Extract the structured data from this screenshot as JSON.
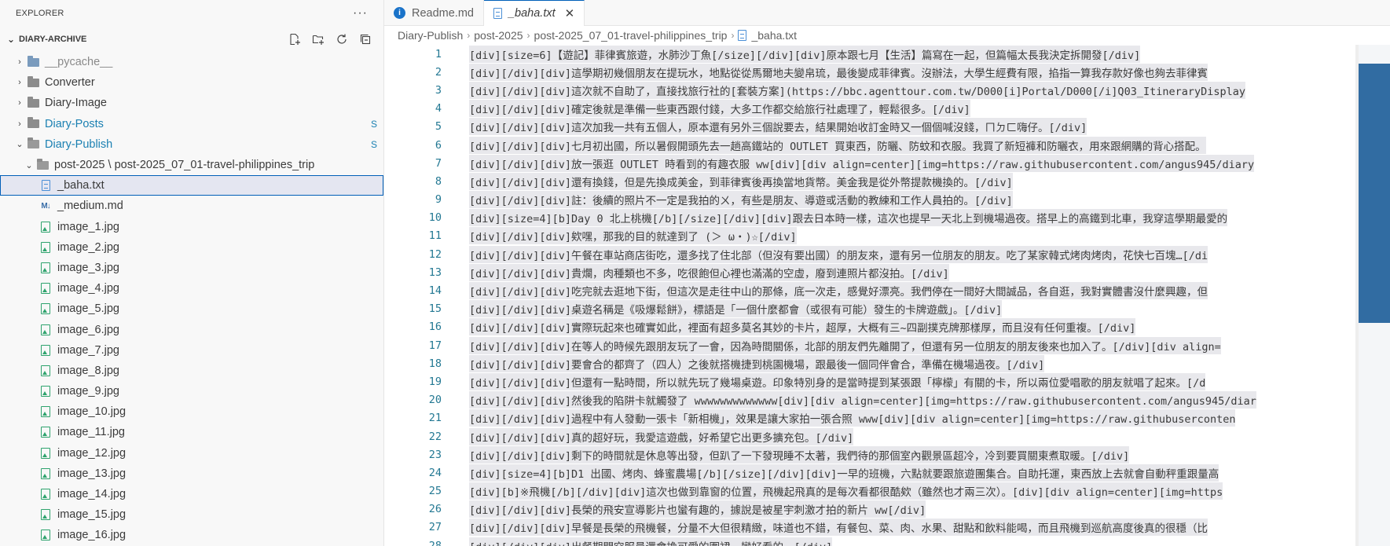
{
  "sidebar": {
    "header": "EXPLORER",
    "more_label": "···",
    "section_title": "DIARY-ARCHIVE",
    "actions": [
      "new-file-icon",
      "new-folder-icon",
      "refresh-icon",
      "collapse-all-icon"
    ],
    "items": [
      {
        "label": "__pycache__",
        "kind": "folder-py",
        "depth": 1,
        "twisty": "›",
        "badge": "",
        "style": "dim"
      },
      {
        "label": "Converter",
        "kind": "folder",
        "depth": 1,
        "twisty": "›",
        "badge": "",
        "style": ""
      },
      {
        "label": "Diary-Image",
        "kind": "folder",
        "depth": 1,
        "twisty": "›",
        "badge": "",
        "style": ""
      },
      {
        "label": "Diary-Posts",
        "kind": "folder",
        "depth": 1,
        "twisty": "›",
        "badge": "S",
        "style": "mod"
      },
      {
        "label": "Diary-Publish",
        "kind": "folder-open",
        "depth": 1,
        "twisty": "⌄",
        "badge": "S",
        "style": "mod"
      },
      {
        "label": "post-2025 \\ post-2025_07_01-travel-philippines_trip",
        "kind": "folder-open",
        "depth": 2,
        "twisty": "⌄",
        "badge": "",
        "style": ""
      },
      {
        "label": "_baha.txt",
        "kind": "txt",
        "depth": 3,
        "twisty": "",
        "badge": "",
        "style": "",
        "selected": true
      },
      {
        "label": "_medium.md",
        "kind": "md",
        "depth": 3,
        "twisty": "",
        "badge": "",
        "style": ""
      },
      {
        "label": "image_1.jpg",
        "kind": "img",
        "depth": 3,
        "twisty": "",
        "badge": "",
        "style": ""
      },
      {
        "label": "image_2.jpg",
        "kind": "img",
        "depth": 3,
        "twisty": "",
        "badge": "",
        "style": ""
      },
      {
        "label": "image_3.jpg",
        "kind": "img",
        "depth": 3,
        "twisty": "",
        "badge": "",
        "style": ""
      },
      {
        "label": "image_4.jpg",
        "kind": "img",
        "depth": 3,
        "twisty": "",
        "badge": "",
        "style": ""
      },
      {
        "label": "image_5.jpg",
        "kind": "img",
        "depth": 3,
        "twisty": "",
        "badge": "",
        "style": ""
      },
      {
        "label": "image_6.jpg",
        "kind": "img",
        "depth": 3,
        "twisty": "",
        "badge": "",
        "style": ""
      },
      {
        "label": "image_7.jpg",
        "kind": "img",
        "depth": 3,
        "twisty": "",
        "badge": "",
        "style": ""
      },
      {
        "label": "image_8.jpg",
        "kind": "img",
        "depth": 3,
        "twisty": "",
        "badge": "",
        "style": ""
      },
      {
        "label": "image_9.jpg",
        "kind": "img",
        "depth": 3,
        "twisty": "",
        "badge": "",
        "style": ""
      },
      {
        "label": "image_10.jpg",
        "kind": "img",
        "depth": 3,
        "twisty": "",
        "badge": "",
        "style": ""
      },
      {
        "label": "image_11.jpg",
        "kind": "img",
        "depth": 3,
        "twisty": "",
        "badge": "",
        "style": ""
      },
      {
        "label": "image_12.jpg",
        "kind": "img",
        "depth": 3,
        "twisty": "",
        "badge": "",
        "style": ""
      },
      {
        "label": "image_13.jpg",
        "kind": "img",
        "depth": 3,
        "twisty": "",
        "badge": "",
        "style": ""
      },
      {
        "label": "image_14.jpg",
        "kind": "img",
        "depth": 3,
        "twisty": "",
        "badge": "",
        "style": ""
      },
      {
        "label": "image_15.jpg",
        "kind": "img",
        "depth": 3,
        "twisty": "",
        "badge": "",
        "style": ""
      },
      {
        "label": "image_16.jpg",
        "kind": "img",
        "depth": 3,
        "twisty": "",
        "badge": "",
        "style": ""
      }
    ]
  },
  "tabs": [
    {
      "label": "Readme.md",
      "icon": "info-icon",
      "active": false
    },
    {
      "label": "_baha.txt",
      "icon": "text-file-icon",
      "active": true,
      "close": "✕"
    }
  ],
  "breadcrumb": [
    "Diary-Publish",
    "post-2025",
    "post-2025_07_01-travel-philippines_trip",
    "_baha.txt"
  ],
  "breadcrumb_sep": "›",
  "colors": {
    "accent": "#005fb8",
    "badge": "#1b80b2",
    "line_number": "#237893",
    "minimap_slider": "#1f5f9a"
  },
  "editor": {
    "lines": [
      "[div][size=6]【遊記】菲律賓旅遊，水肺沙丁魚[/size][/div][div]原本跟七月【生活】篇寫在一起，但篇幅太長我決定拆開發[/div]",
      "[div][/div][div]這學期初幾個朋友在提玩水，地點從從馬爾地夫變帛琉，最後變成菲律賓。沒辦法，大學生經費有限，掐指一算我存款好像也夠去菲律賓",
      "[div][/div][div]這次就不自助了，直接找旅行社的[套裝方案](https://bbc.agenttour.com.tw/D000[i]Portal/D000[/i]Q03_ItineraryDisplay",
      "[div][/div][div]確定後就是準備一些東西跟付錢，大多工作都交給旅行社處理了，輕鬆很多。[/div]",
      "[div][/div][div]這次加我一共有五個人，原本還有另外三個說要去，結果開始收訂金時又一個個喊沒錢，ㄇㄉㄈ嗨仔。[/div]",
      "[div][/div][div]七月初出國，所以暑假開頭先去一趟高鐵站的 OUTLET 買東西，防曬、防蚊和衣服。我買了新短褲和防曬衣，用來跟網購的背心搭配。",
      "[div][/div][div]放一張逛 OUTLET 時看到的有趣衣服 ww[div][div align=center][img=https://raw.githubusercontent.com/angus945/diary",
      "[div][/div][div]還有換錢，但是先換成美金，到菲律賓後再換當地貨幣。美金我是從外幣提款機換的。[/div]",
      "[div][/div][div]註：後續的照片不一定是我拍的ㄨ，有些是朋友、導遊或活動的教練和工作人員拍的。[/div]",
      "[div][size=4][b]Day 0 北上桃機[/b][/size][/div][div]跟去日本時一樣，這次也提早一天北上到機場過夜。搭早上的高鐵到北車，我穿這學期最愛的",
      "[div][/div][div]欸嘿，那我的目的就達到了 (＞ ω・)☆[/div]",
      "[div][/div][div]午餐在車站商店街吃，還多找了住北部（但沒有要出國）的朋友來，還有另一位朋友的朋友。吃了某家韓式烤肉烤肉，花快七百塊…[/di",
      "[div][/div][div]貴爛，肉種類也不多，吃很飽但心裡也滿滿的空虛，廢到連照片都沒拍。[/div]",
      "[div][/div][div]吃完就去逛地下街，但這次是走往中山的那條，底一次走，感覺好漂亮。我們停在一間好大間誠品，各自逛，我對實體書沒什麼興趣，但",
      "[div][/div][div]桌遊名稱是《吸爆鬆餅》，標語是「一個什麼都會（或很有可能）發生的卡牌遊戲」。[/div]",
      "[div][/div][div]實際玩起來也確實如此，裡面有超多莫名其妙的卡片，超厚，大概有三~四副撲克牌那樣厚，而且沒有任何重複。[/div]",
      "[div][/div][div]在等人的時候先跟朋友玩了一會，因為時間關係，北部的朋友們先離開了，但還有另一位朋友的朋友後來也加入了。[/div][div align=",
      "[div][/div][div]要會合的都齊了（四人）之後就搭機捷到桃園機場，跟最後一個同伴會合，準備在機場過夜。[/div]",
      "[div][/div][div]但還有一點時間，所以就先玩了幾場桌遊。印象特別身的是當時提到某張跟「檸檬」有關的卡，所以兩位愛唱歌的朋友就唱了起來。[/d",
      "[div][/div][div]然後我的陷阱卡就觸發了 wwwwwwwwwwwww[div][div align=center][img=https://raw.githubusercontent.com/angus945/diar",
      "[div][/div][div]過程中有人發動一張卡「新相機」，效果是讓大家拍一張合照 www[div][div align=center][img=https://raw.githubuserconten",
      "[div][/div][div]真的超好玩，我愛這遊戲，好希望它出更多擴充包。[/div]",
      "[div][/div][div]剩下的時間就是休息等出發，但趴了一下發現睡不太著，我們待的那個室內觀景區超冷，冷到要買關東煮取暖。[/div]",
      "[div][size=4][b]D1 出國、烤肉、蜂蜜農場[/b][/size][/div][div]一早的班機，六點就要跟旅遊團集合。自助托運，東西放上去就會自動秤重跟量高",
      "[div][b]※飛機[/b][/div][div]這次也做到靠窗的位置，飛機起飛真的是每次看都很酷欸（雖然也才兩三次）。[div][div align=center][img=https",
      "[div][/div][div]長榮的飛安宣導影片也蠻有趣的，據說是被星宇刺激才拍的新片 ww[/div]",
      "[div][/div][div]早餐是長榮的飛機餐，分量不大但很精緻，味道也不錯，有餐包、菜、肉、水果、甜點和飲料能喝，而且飛機到巡航高度後真的很穩（比",
      "[div][/div][div]出餐期間空服員還會換可愛的圍裙，蠻好看的。[/div]"
    ]
  }
}
